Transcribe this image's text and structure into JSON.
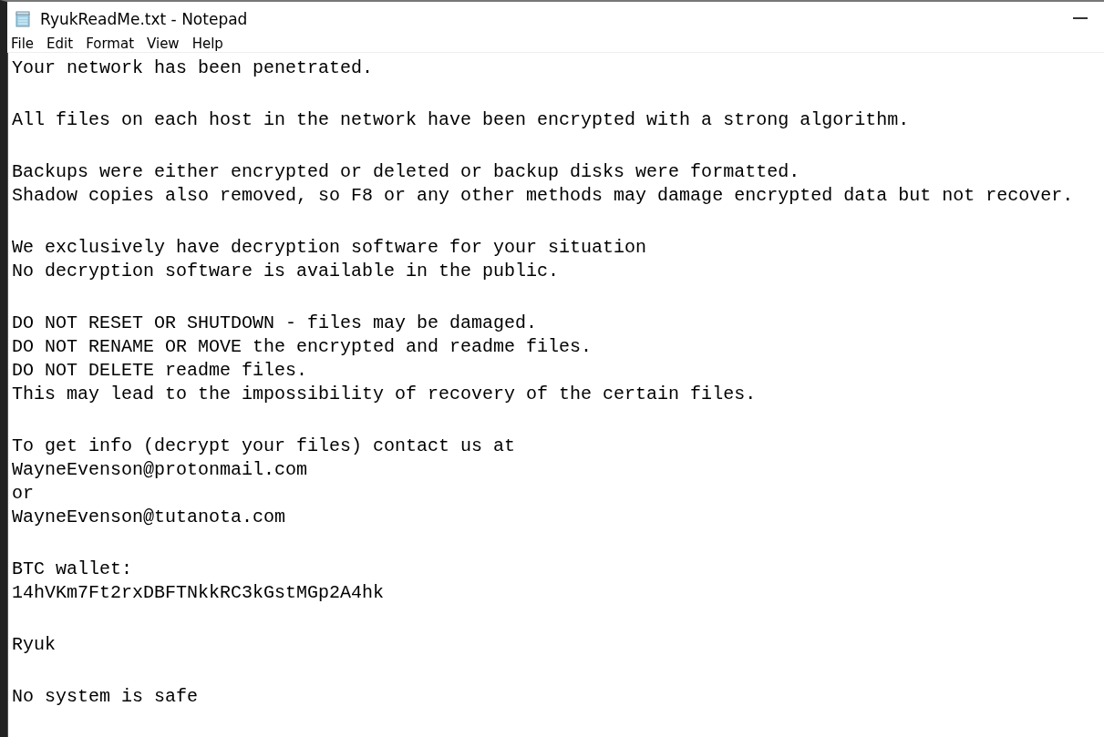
{
  "window": {
    "title": "RyukReadMe.txt - Notepad"
  },
  "menu": [
    "File",
    "Edit",
    "Format",
    "View",
    "Help"
  ],
  "document": {
    "paragraphs": [
      [
        "Your network has been penetrated."
      ],
      [
        "All files on each host in the network have been encrypted with a strong algorithm."
      ],
      [
        "Backups were either encrypted or deleted or backup disks were formatted.",
        "Shadow copies also removed, so F8 or any other methods may damage encrypted data but not recover."
      ],
      [
        "We exclusively have decryption software for your situation",
        "No decryption software is available in the public."
      ],
      [
        "DO NOT RESET OR SHUTDOWN - files may be damaged.",
        "DO NOT RENAME OR MOVE the encrypted and readme files.",
        "DO NOT DELETE readme files.",
        "This may lead to the impossibility of recovery of the certain files."
      ],
      [
        "To get info (decrypt your files) contact us at",
        "WayneEvenson@protonmail.com",
        "or",
        "WayneEvenson@tutanota.com"
      ],
      [
        "BTC wallet:",
        "14hVKm7Ft2rxDBFTNkkRC3kGstMGp2A4hk"
      ],
      [
        "Ryuk"
      ],
      [
        "No system is safe"
      ]
    ]
  }
}
